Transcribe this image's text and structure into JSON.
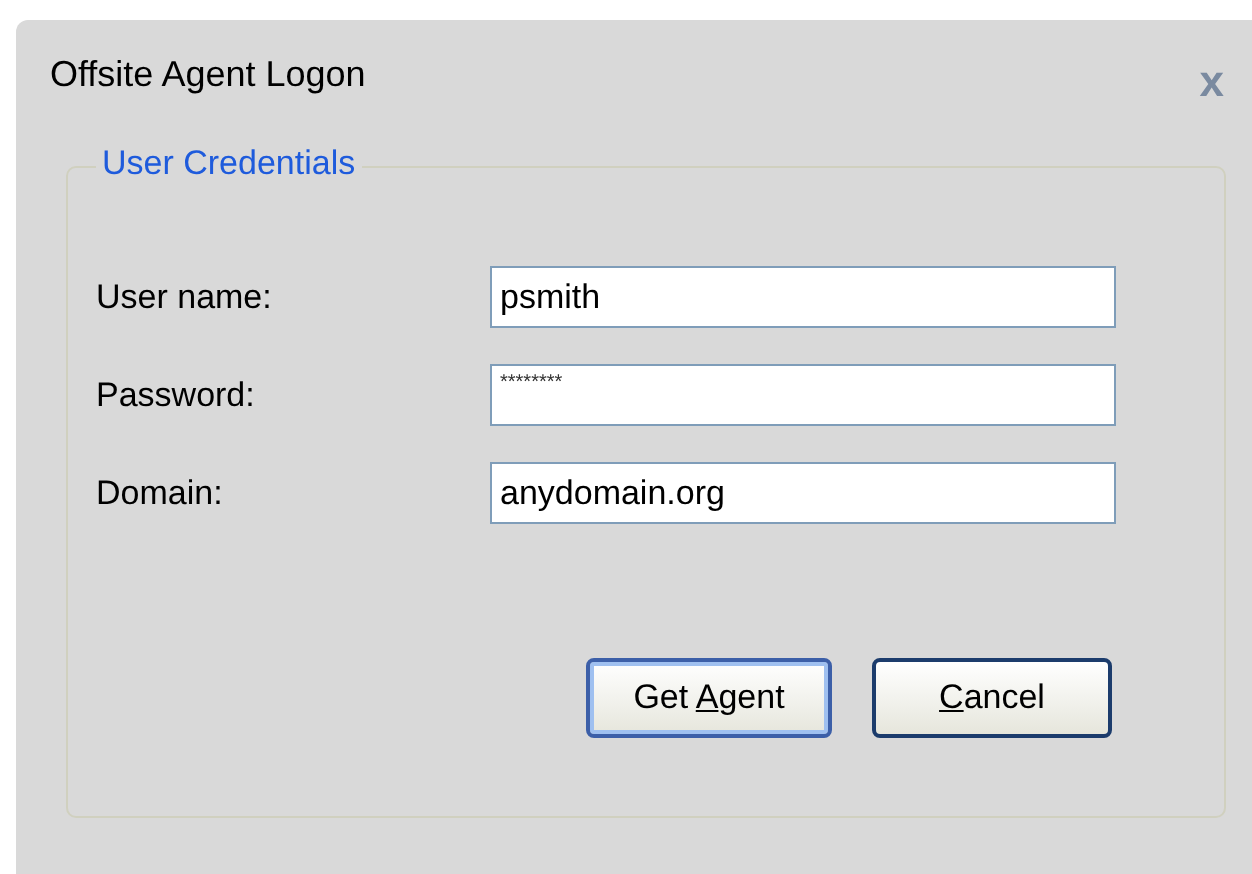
{
  "window": {
    "title": "Offsite Agent Logon",
    "close": "x"
  },
  "group": {
    "title": "User Credentials"
  },
  "fields": [
    {
      "kind": "text",
      "label": "User name:",
      "value": "psmith"
    },
    {
      "kind": "password",
      "label": "Password:",
      "value": "********"
    },
    {
      "kind": "text",
      "label": "Domain:",
      "value": "anydomain.org"
    }
  ],
  "buttons": [
    {
      "before": "Get ",
      "key": "A",
      "after": "gent",
      "default": true
    },
    {
      "key": "C",
      "after": "ancel",
      "default": false
    }
  ]
}
